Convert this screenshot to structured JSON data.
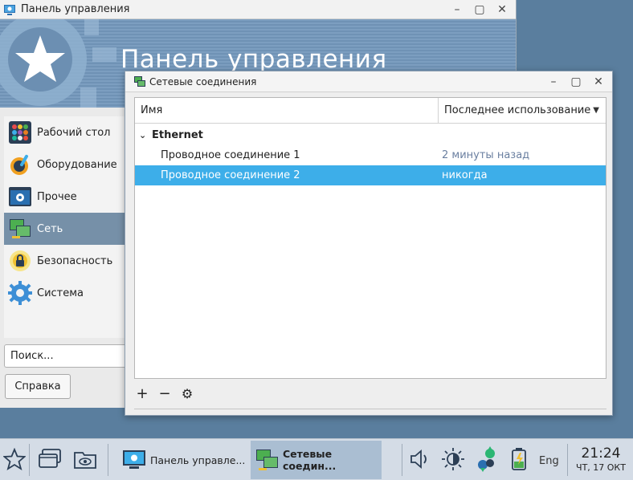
{
  "control_panel": {
    "window_title": "Панель управления",
    "banner_title": "Панель управления",
    "sidebar": [
      {
        "label": "Рабочий стол",
        "icon": "desktop-grid-icon"
      },
      {
        "label": "Оборудование",
        "icon": "hardware-icon"
      },
      {
        "label": "Прочее",
        "icon": "other-settings-icon"
      },
      {
        "label": "Сеть",
        "icon": "network-icon",
        "selected": true
      },
      {
        "label": "Безопасность",
        "icon": "security-lock-icon"
      },
      {
        "label": "Система",
        "icon": "system-gear-icon"
      }
    ],
    "search_placeholder": "Поиск...",
    "help_button": "Справка"
  },
  "network_window": {
    "title": "Сетевые соединения",
    "columns": {
      "name": "Имя",
      "last_used": "Последнее использование"
    },
    "group": "Ethernet",
    "connections": [
      {
        "name": "Проводное соединение 1",
        "last_used": "2 минуты назад",
        "selected": false
      },
      {
        "name": "Проводное соединение 2",
        "last_used": "никогда",
        "selected": true
      }
    ],
    "toolbar": {
      "add": "+",
      "remove": "−",
      "settings": "⚙"
    }
  },
  "taskbar": {
    "tasks": [
      {
        "label": "Панель управле...",
        "active": false
      },
      {
        "label": "Сетевые соедин...",
        "active": true
      }
    ],
    "language": "Eng",
    "time": "21:24",
    "date": "ЧТ, 17 ОКТ"
  },
  "colors": {
    "desktop": "#5a7e9e",
    "selection": "#3daee9",
    "sidebar_selected": "#7690a8",
    "taskbar": "#d4dce6"
  }
}
